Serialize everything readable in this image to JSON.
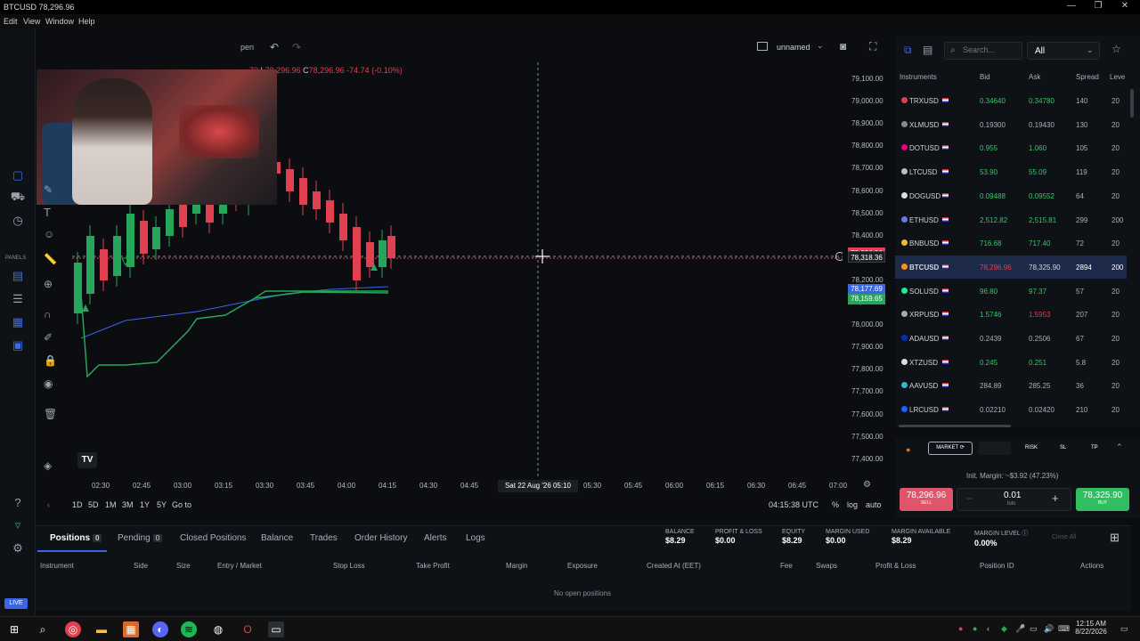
{
  "window": {
    "title": "BTCUSD 78,296.96",
    "min": "—",
    "max": "❐",
    "close": "✕"
  },
  "menu": [
    "Edit",
    "View",
    "Window",
    "Help"
  ],
  "chart_toolbar": {
    "partial_label": "pen",
    "layout_name": "unnamed"
  },
  "ohlc": {
    "open_frag": "70",
    "low_key": "L",
    "low": "78,296.96",
    "close_key": "C",
    "close": "78,296.96",
    "change": "-74.74 (-0.10%)"
  },
  "price_axis": [
    "79,100.00",
    "79,000.00",
    "78,900.00",
    "78,800.00",
    "78,700.00",
    "78,600.00",
    "78,500.00",
    "78,400.00",
    "78,300.00",
    "78,200.00",
    "78,100.00",
    "78,000.00",
    "77,900.00",
    "77,800.00",
    "77,700.00",
    "77,600.00",
    "77,500.00",
    "77,400.00"
  ],
  "price_labels": {
    "crosshair": "78,318.36",
    "last": "78,296.96",
    "ma_blue": "78,177.69",
    "ma_green": "78,159.65"
  },
  "time_axis": [
    "02:30",
    "02:45",
    "03:00",
    "03:15",
    "03:30",
    "03:45",
    "04:00",
    "04:15",
    "04:30",
    "04:45",
    "05:30",
    "05:45",
    "06:00",
    "06:15",
    "06:30",
    "06:45",
    "07:00"
  ],
  "crosshair_time": "Sat 22 Aug '26  05:10",
  "ranges": [
    "1D",
    "5D",
    "1M",
    "3M",
    "1Y",
    "5Y",
    "Go to"
  ],
  "clock": "04:15:38 UTC",
  "axis_opts": [
    "%",
    "log",
    "auto"
  ],
  "left_panel_label": "PANELS",
  "live_badge": "LIVE",
  "instruments": {
    "search_placeholder": "Search...",
    "filter": "All",
    "headers": [
      "Instruments",
      "Bid",
      "Ask",
      "Spread",
      "Leve"
    ],
    "rows": [
      {
        "sym": "TRXUSD",
        "bid": "0.34640",
        "ask": "0.34780",
        "spread": "140",
        "lev": "20",
        "dot": "#e0404f"
      },
      {
        "sym": "XLMUSD",
        "bid": "0.19300",
        "ask": "0.19430",
        "spread": "130",
        "lev": "20",
        "dot": "#888888"
      },
      {
        "sym": "DOTUSD",
        "bid": "0.955",
        "ask": "1.060",
        "spread": "105",
        "lev": "20",
        "dot": "#e6007a"
      },
      {
        "sym": "LTCUSD",
        "bid": "53.90",
        "ask": "55.09",
        "spread": "119",
        "lev": "20",
        "dot": "#bebebe"
      },
      {
        "sym": "DOGUSD",
        "bid": "0.09488",
        "ask": "0.09552",
        "spread": "64",
        "lev": "20",
        "dot": "#dddddd"
      },
      {
        "sym": "ETHUSD",
        "bid": "2,512.82",
        "ask": "2,515.81",
        "spread": "299",
        "lev": "200",
        "dot": "#627eea"
      },
      {
        "sym": "BNBUSD",
        "bid": "716.68",
        "ask": "717.40",
        "spread": "72",
        "lev": "20",
        "dot": "#f3ba2f"
      },
      {
        "sym": "BTCUSD",
        "bid": "78,296.96",
        "ask": "78,325.90",
        "spread": "2894",
        "lev": "200",
        "dot": "#f7931a"
      },
      {
        "sym": "SOLUSD",
        "bid": "96.80",
        "ask": "97.37",
        "spread": "57",
        "lev": "20",
        "dot": "#14f195"
      },
      {
        "sym": "XRPUSD",
        "bid": "1.5746",
        "ask": "1.5953",
        "spread": "207",
        "lev": "20",
        "dot": "#aaaaaa"
      },
      {
        "sym": "ADAUSD",
        "bid": "0.2439",
        "ask": "0.2506",
        "spread": "67",
        "lev": "20",
        "dot": "#0033ad"
      },
      {
        "sym": "XTZUSD",
        "bid": "0.245",
        "ask": "0.251",
        "spread": "5.8",
        "lev": "20",
        "dot": "#dddddd"
      },
      {
        "sym": "AAVUSD",
        "bid": "284.89",
        "ask": "285.25",
        "spread": "36",
        "lev": "20",
        "dot": "#2ebac6"
      },
      {
        "sym": "LRCUSD",
        "bid": "0.02210",
        "ask": "0.02420",
        "spread": "210",
        "lev": "20",
        "dot": "#1c60ff"
      }
    ]
  },
  "order": {
    "market": "MARKET",
    "risk": "RISK",
    "sl": "SL",
    "tp": "TP",
    "margin": "Init. Margin: ~$3.92 (47.23%)",
    "sell_price": "78,296.96",
    "sell_label": "SELL",
    "lots": "0.01",
    "lots_label": "lots",
    "buy_price": "78,325.90",
    "buy_label": "BUY"
  },
  "positions": {
    "tabs": [
      {
        "label": "Positions",
        "count": "0"
      },
      {
        "label": "Pending",
        "count": "0"
      },
      {
        "label": "Closed Positions"
      },
      {
        "label": "Balance"
      },
      {
        "label": "Trades"
      },
      {
        "label": "Order History"
      },
      {
        "label": "Alerts"
      },
      {
        "label": "Logs"
      }
    ],
    "stats": [
      {
        "k": "BALANCE",
        "v": "$8.29"
      },
      {
        "k": "PROFIT & LOSS",
        "v": "$0.00"
      },
      {
        "k": "EQUITY",
        "v": "$8.29"
      },
      {
        "k": "MARGIN USED",
        "v": "$0.00"
      },
      {
        "k": "MARGIN AVAILABLE",
        "v": "$8.29"
      },
      {
        "k": "MARGIN LEVEL",
        "v": "0.00%"
      }
    ],
    "close_all": "Close All",
    "columns": [
      "Instrument",
      "Side",
      "Size",
      "Entry / Market",
      "Stop Loss",
      "Take Profit",
      "Margin",
      "Exposure",
      "Created At (EET)",
      "Fee",
      "Swaps",
      "Profit & Loss",
      "Position ID",
      "Actions"
    ],
    "empty": "No open positions"
  },
  "taskbar": {
    "time": "12:15 AM",
    "date": "8/22/2026"
  },
  "colors": {
    "bull": "#26a65b",
    "bear": "#e0404f",
    "accent": "#3a66e6"
  }
}
